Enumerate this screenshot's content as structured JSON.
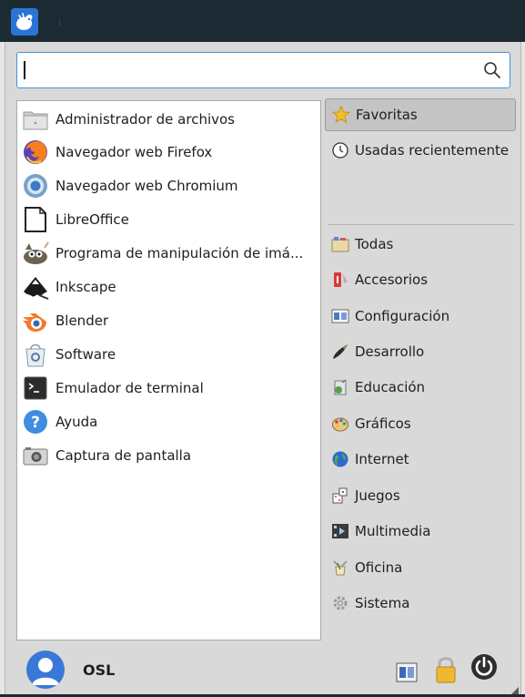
{
  "search": {
    "value": "",
    "placeholder": ""
  },
  "apps": [
    {
      "label": "Administrador de archivos",
      "icon": "folder-icon"
    },
    {
      "label": "Navegador web Firefox",
      "icon": "firefox-icon"
    },
    {
      "label": "Navegador web Chromium",
      "icon": "chromium-icon"
    },
    {
      "label": "LibreOffice",
      "icon": "libreoffice-icon"
    },
    {
      "label": "Programa de manipulación de imá...",
      "icon": "gimp-icon"
    },
    {
      "label": "Inkscape",
      "icon": "inkscape-icon"
    },
    {
      "label": "Blender",
      "icon": "blender-icon"
    },
    {
      "label": "Software",
      "icon": "software-icon"
    },
    {
      "label": "Emulador de terminal",
      "icon": "terminal-icon"
    },
    {
      "label": "Ayuda",
      "icon": "help-icon"
    },
    {
      "label": "Captura de pantalla",
      "icon": "camera-icon"
    }
  ],
  "categories": [
    {
      "label": "Favoritas",
      "icon": "star-icon",
      "selected": true
    },
    {
      "label": "Usadas recientemente",
      "icon": "clock-icon"
    },
    {
      "label": "Todas",
      "icon": "all-apps-icon"
    },
    {
      "label": "Accesorios",
      "icon": "accessories-icon"
    },
    {
      "label": "Configuración",
      "icon": "settings-icon"
    },
    {
      "label": "Desarrollo",
      "icon": "development-icon"
    },
    {
      "label": "Educación",
      "icon": "education-icon"
    },
    {
      "label": "Gráficos",
      "icon": "graphics-icon"
    },
    {
      "label": "Internet",
      "icon": "internet-icon"
    },
    {
      "label": "Juegos",
      "icon": "games-icon"
    },
    {
      "label": "Multimedia",
      "icon": "multimedia-icon"
    },
    {
      "label": "Oficina",
      "icon": "office-icon"
    },
    {
      "label": "Sistema",
      "icon": "system-icon"
    }
  ],
  "user": {
    "name": "OSL"
  },
  "actions": [
    {
      "name": "settings-manager-icon"
    },
    {
      "name": "lock-icon"
    },
    {
      "name": "power-icon"
    }
  ],
  "colors": {
    "panel": "#1c2a33",
    "accent": "#4a90d9",
    "selected": "#c4c4c4"
  }
}
